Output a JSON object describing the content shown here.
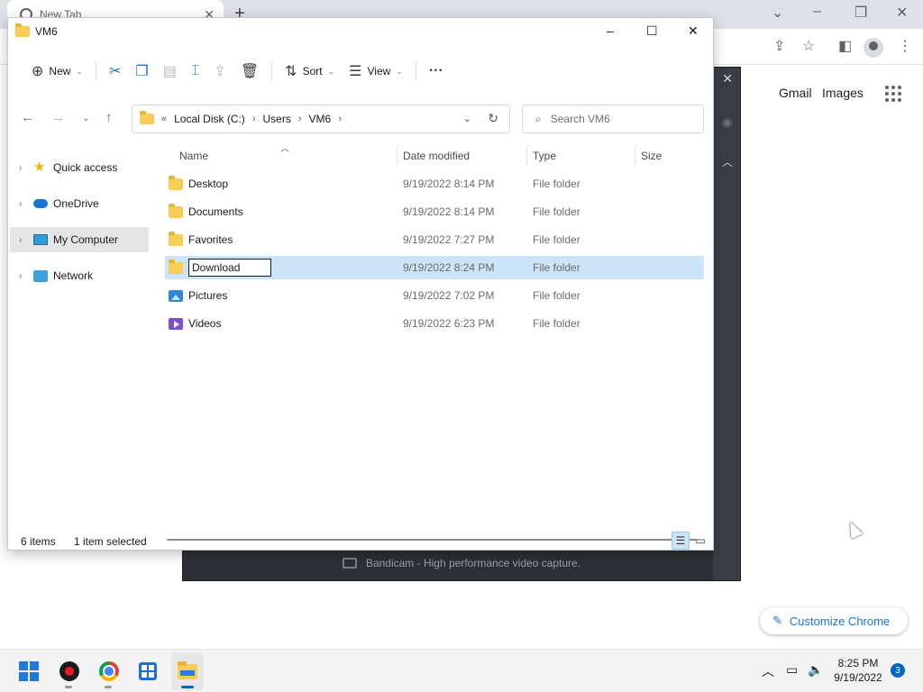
{
  "chrome": {
    "tab_title": "New Tab",
    "links": {
      "gmail": "Gmail",
      "images": "Images"
    },
    "customize_label": "Customize Chrome"
  },
  "bandicam": {
    "status_text": "Bandicam - High performance video capture."
  },
  "explorer": {
    "title": "VM6",
    "commands": {
      "new_label": "New",
      "sort_label": "Sort",
      "view_label": "View",
      "more_label": "···"
    },
    "address": {
      "overflow": "«",
      "crumbs": [
        "Local Disk (C:)",
        "Users",
        "VM6"
      ]
    },
    "search_placeholder": "Search VM6",
    "nav_items": [
      {
        "label": "Quick access",
        "icon": "star-icon"
      },
      {
        "label": "OneDrive",
        "icon": "cloud-icon"
      },
      {
        "label": "My Computer",
        "icon": "computer-icon"
      },
      {
        "label": "Network",
        "icon": "network-icon"
      }
    ],
    "columns": {
      "name": "Name",
      "date": "Date modified",
      "type": "Type",
      "size": "Size"
    },
    "files": [
      {
        "name": "Desktop",
        "date": "9/19/2022 8:14 PM",
        "type": "File folder",
        "icon": "folder-icon"
      },
      {
        "name": "Documents",
        "date": "9/19/2022 8:14 PM",
        "type": "File folder",
        "icon": "folder-icon"
      },
      {
        "name": "Favorites",
        "date": "9/19/2022 7:27 PM",
        "type": "File folder",
        "icon": "folder-icon"
      },
      {
        "name": "Download",
        "date": "9/19/2022 8:24 PM",
        "type": "File folder",
        "icon": "folder-icon",
        "renaming": true
      },
      {
        "name": "Pictures",
        "date": "9/19/2022 7:02 PM",
        "type": "File folder",
        "icon": "pictures-icon"
      },
      {
        "name": "Videos",
        "date": "9/19/2022 6:23 PM",
        "type": "File folder",
        "icon": "videos-icon"
      }
    ],
    "status": {
      "item_count": "6 items",
      "selection": "1 item selected"
    }
  },
  "taskbar": {
    "time": "8:25 PM",
    "date": "9/19/2022",
    "notification_count": "3"
  },
  "colors": {
    "selection": "#cce4f7",
    "accent": "#0067c0",
    "chrome_link": "#1a73e8"
  }
}
